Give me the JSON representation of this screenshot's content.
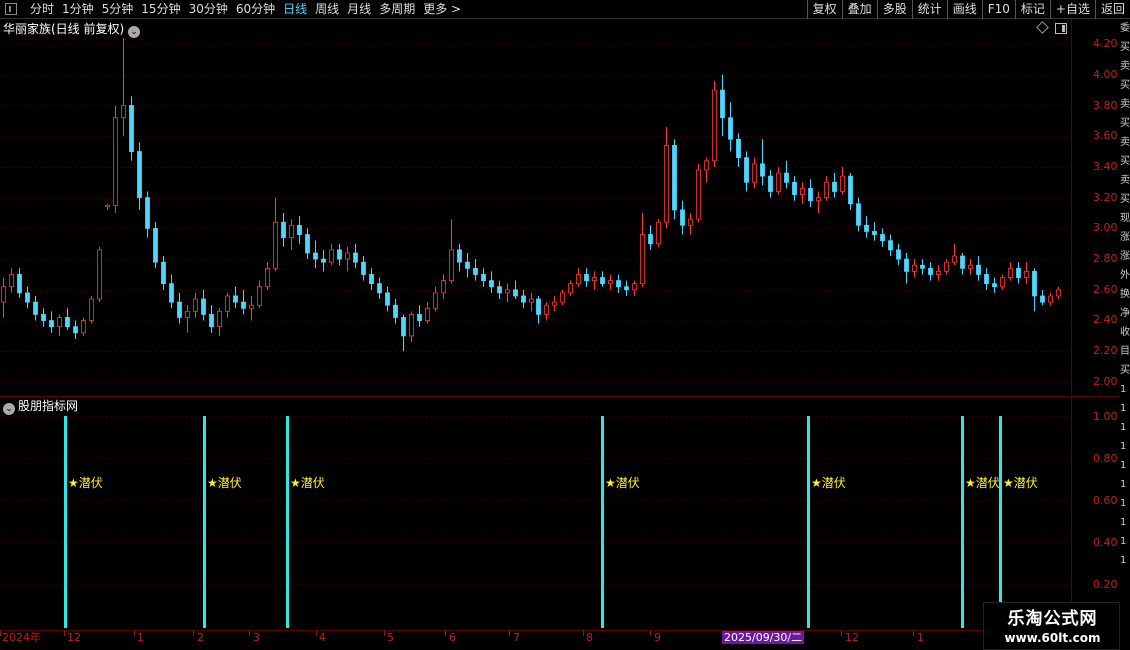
{
  "toolbar": {
    "period_tabs": [
      "分时",
      "1分钟",
      "5分钟",
      "15分钟",
      "30分钟",
      "60分钟",
      "日线",
      "周线",
      "月线",
      "多周期",
      "更多 >"
    ],
    "active_tab": "日线",
    "right_tools": [
      "复权",
      "叠加",
      "多股",
      "统计",
      "画线",
      "F10",
      "标记",
      "+自选",
      "返回"
    ]
  },
  "main_panel": {
    "title": "华丽家族(日线 前复权)",
    "price_axis": [
      "4.20",
      "4.00",
      "3.80",
      "3.60",
      "3.40",
      "3.20",
      "3.00",
      "2.80",
      "2.60",
      "2.40",
      "2.20",
      "2.00"
    ]
  },
  "indicator_panel": {
    "title": "股朋指标网",
    "axis": [
      "1.00",
      "0.80",
      "0.60",
      "0.40",
      "0.20"
    ],
    "signal_label": "★潜伏",
    "signals": [
      {
        "label": "★潜伏"
      },
      {
        "label": "★潜伏"
      },
      {
        "label": "★潜伏"
      },
      {
        "label": "★潜伏"
      },
      {
        "label": "★潜伏"
      },
      {
        "label": "★潜伏"
      },
      {
        "label": "★潜伏"
      }
    ]
  },
  "date_axis": {
    "labels": [
      "2024年",
      "12",
      "1",
      "2",
      "3",
      "4",
      "5",
      "6",
      "7",
      "8",
      "9",
      "12",
      "1"
    ],
    "cursor_date": "2025/09/30/二"
  },
  "right_strip": [
    "委",
    "买",
    "卖",
    "买",
    "卖",
    "买",
    "卖",
    "买",
    "卖",
    "买",
    "现",
    "涨",
    "涨",
    "外",
    "换",
    "净",
    "收",
    "目",
    "买",
    "1",
    "1",
    "1",
    "1",
    "1",
    "1",
    "1",
    "1",
    "1",
    "1"
  ],
  "watermark": {
    "title": "乐淘公式网",
    "url": "www.60lt.com"
  },
  "chart_data": {
    "type": "candlestick",
    "title": "华丽家族(日线 前复权)",
    "ylim": [
      2.0,
      4.2
    ],
    "up_color": "#ff3a3a",
    "down_color": "#4fd6ff",
    "indicator_color": "#2ee6e6",
    "ohlc": [
      [
        2.52,
        2.68,
        2.42,
        2.62
      ],
      [
        2.62,
        2.74,
        2.58,
        2.7
      ],
      [
        2.7,
        2.74,
        2.55,
        2.58
      ],
      [
        2.58,
        2.62,
        2.48,
        2.52
      ],
      [
        2.52,
        2.56,
        2.4,
        2.44
      ],
      [
        2.44,
        2.48,
        2.36,
        2.4
      ],
      [
        2.4,
        2.46,
        2.32,
        2.36
      ],
      [
        2.36,
        2.44,
        2.3,
        2.42
      ],
      [
        2.42,
        2.48,
        2.34,
        2.36
      ],
      [
        2.36,
        2.4,
        2.28,
        2.32
      ],
      [
        2.32,
        2.42,
        2.3,
        2.4
      ],
      [
        2.4,
        2.56,
        2.38,
        2.54
      ],
      [
        2.54,
        2.88,
        2.52,
        2.86
      ],
      [
        3.14,
        3.16,
        3.12,
        3.15
      ],
      [
        3.15,
        3.8,
        3.1,
        3.72
      ],
      [
        3.72,
        4.24,
        3.6,
        3.8
      ],
      [
        3.8,
        3.86,
        3.44,
        3.5
      ],
      [
        3.5,
        3.56,
        3.12,
        3.2
      ],
      [
        3.2,
        3.24,
        2.94,
        3.0
      ],
      [
        3.0,
        3.04,
        2.74,
        2.78
      ],
      [
        2.78,
        2.82,
        2.6,
        2.64
      ],
      [
        2.64,
        2.7,
        2.48,
        2.52
      ],
      [
        2.52,
        2.58,
        2.38,
        2.42
      ],
      [
        2.42,
        2.5,
        2.32,
        2.46
      ],
      [
        2.46,
        2.58,
        2.42,
        2.54
      ],
      [
        2.54,
        2.6,
        2.4,
        2.44
      ],
      [
        2.44,
        2.5,
        2.32,
        2.36
      ],
      [
        2.36,
        2.48,
        2.3,
        2.46
      ],
      [
        2.46,
        2.58,
        2.42,
        2.56
      ],
      [
        2.56,
        2.62,
        2.48,
        2.52
      ],
      [
        2.52,
        2.6,
        2.44,
        2.48
      ],
      [
        2.48,
        2.56,
        2.4,
        2.5
      ],
      [
        2.5,
        2.66,
        2.48,
        2.62
      ],
      [
        2.62,
        2.78,
        2.6,
        2.74
      ],
      [
        2.74,
        3.2,
        2.72,
        3.04
      ],
      [
        3.04,
        3.1,
        2.88,
        2.94
      ],
      [
        2.94,
        3.06,
        2.86,
        3.02
      ],
      [
        3.02,
        3.08,
        2.9,
        2.96
      ],
      [
        2.96,
        3.0,
        2.8,
        2.84
      ],
      [
        2.84,
        2.92,
        2.74,
        2.8
      ],
      [
        2.8,
        2.86,
        2.72,
        2.78
      ],
      [
        2.78,
        2.9,
        2.76,
        2.86
      ],
      [
        2.86,
        2.9,
        2.76,
        2.8
      ],
      [
        2.8,
        2.88,
        2.72,
        2.84
      ],
      [
        2.84,
        2.9,
        2.74,
        2.78
      ],
      [
        2.78,
        2.82,
        2.66,
        2.7
      ],
      [
        2.7,
        2.74,
        2.6,
        2.64
      ],
      [
        2.64,
        2.68,
        2.54,
        2.58
      ],
      [
        2.58,
        2.62,
        2.46,
        2.5
      ],
      [
        2.5,
        2.54,
        2.38,
        2.42
      ],
      [
        2.42,
        2.44,
        2.2,
        2.3
      ],
      [
        2.3,
        2.46,
        2.26,
        2.44
      ],
      [
        2.44,
        2.5,
        2.36,
        2.4
      ],
      [
        2.4,
        2.52,
        2.38,
        2.48
      ],
      [
        2.48,
        2.62,
        2.46,
        2.58
      ],
      [
        2.58,
        2.7,
        2.54,
        2.66
      ],
      [
        2.66,
        3.06,
        2.64,
        2.86
      ],
      [
        2.86,
        2.9,
        2.72,
        2.78
      ],
      [
        2.78,
        2.84,
        2.68,
        2.74
      ],
      [
        2.74,
        2.8,
        2.66,
        2.7
      ],
      [
        2.7,
        2.74,
        2.62,
        2.66
      ],
      [
        2.66,
        2.72,
        2.58,
        2.62
      ],
      [
        2.62,
        2.66,
        2.54,
        2.58
      ],
      [
        2.58,
        2.64,
        2.52,
        2.6
      ],
      [
        2.6,
        2.66,
        2.54,
        2.56
      ],
      [
        2.56,
        2.6,
        2.48,
        2.52
      ],
      [
        2.52,
        2.58,
        2.46,
        2.54
      ],
      [
        2.54,
        2.56,
        2.38,
        2.44
      ],
      [
        2.44,
        2.52,
        2.4,
        2.5
      ],
      [
        2.5,
        2.56,
        2.46,
        2.52
      ],
      [
        2.52,
        2.6,
        2.5,
        2.58
      ],
      [
        2.58,
        2.66,
        2.56,
        2.64
      ],
      [
        2.64,
        2.74,
        2.62,
        2.7
      ],
      [
        2.7,
        2.74,
        2.62,
        2.66
      ],
      [
        2.66,
        2.72,
        2.6,
        2.68
      ],
      [
        2.68,
        2.72,
        2.62,
        2.64
      ],
      [
        2.64,
        2.7,
        2.6,
        2.66
      ],
      [
        2.66,
        2.7,
        2.58,
        2.62
      ],
      [
        2.62,
        2.66,
        2.56,
        2.6
      ],
      [
        2.6,
        2.66,
        2.56,
        2.64
      ],
      [
        2.64,
        3.1,
        2.62,
        2.96
      ],
      [
        2.96,
        3.02,
        2.86,
        2.9
      ],
      [
        2.9,
        3.06,
        2.88,
        3.04
      ],
      [
        3.04,
        3.66,
        3.0,
        3.54
      ],
      [
        3.54,
        3.58,
        3.06,
        3.12
      ],
      [
        3.12,
        3.18,
        2.96,
        3.02
      ],
      [
        3.02,
        3.1,
        2.96,
        3.06
      ],
      [
        3.06,
        3.42,
        3.04,
        3.38
      ],
      [
        3.38,
        3.46,
        3.3,
        3.44
      ],
      [
        3.44,
        3.96,
        3.4,
        3.9
      ],
      [
        3.9,
        4.0,
        3.6,
        3.72
      ],
      [
        3.72,
        3.82,
        3.5,
        3.58
      ],
      [
        3.58,
        3.62,
        3.4,
        3.46
      ],
      [
        3.46,
        3.5,
        3.24,
        3.3
      ],
      [
        3.3,
        3.46,
        3.26,
        3.42
      ],
      [
        3.42,
        3.58,
        3.28,
        3.34
      ],
      [
        3.34,
        3.38,
        3.2,
        3.24
      ],
      [
        3.24,
        3.4,
        3.22,
        3.36
      ],
      [
        3.36,
        3.44,
        3.26,
        3.3
      ],
      [
        3.3,
        3.34,
        3.18,
        3.22
      ],
      [
        3.22,
        3.3,
        3.16,
        3.26
      ],
      [
        3.26,
        3.32,
        3.14,
        3.18
      ],
      [
        3.18,
        3.24,
        3.1,
        3.2
      ],
      [
        3.2,
        3.34,
        3.18,
        3.3
      ],
      [
        3.3,
        3.36,
        3.2,
        3.24
      ],
      [
        3.24,
        3.4,
        3.22,
        3.34
      ],
      [
        3.34,
        3.36,
        3.12,
        3.16
      ],
      [
        3.16,
        3.2,
        2.98,
        3.02
      ],
      [
        3.02,
        3.08,
        2.94,
        2.98
      ],
      [
        2.98,
        3.04,
        2.92,
        2.96
      ],
      [
        2.96,
        3.0,
        2.88,
        2.92
      ],
      [
        2.92,
        2.96,
        2.82,
        2.86
      ],
      [
        2.86,
        2.9,
        2.76,
        2.8
      ],
      [
        2.8,
        2.84,
        2.64,
        2.72
      ],
      [
        2.72,
        2.8,
        2.68,
        2.76
      ],
      [
        2.76,
        2.8,
        2.7,
        2.74
      ],
      [
        2.74,
        2.78,
        2.66,
        2.7
      ],
      [
        2.7,
        2.76,
        2.66,
        2.72
      ],
      [
        2.72,
        2.8,
        2.7,
        2.78
      ],
      [
        2.78,
        2.9,
        2.76,
        2.82
      ],
      [
        2.82,
        2.84,
        2.7,
        2.74
      ],
      [
        2.74,
        2.8,
        2.7,
        2.76
      ],
      [
        2.76,
        2.82,
        2.66,
        2.7
      ],
      [
        2.7,
        2.74,
        2.6,
        2.64
      ],
      [
        2.64,
        2.68,
        2.58,
        2.62
      ],
      [
        2.62,
        2.7,
        2.6,
        2.68
      ],
      [
        2.68,
        2.78,
        2.66,
        2.74
      ],
      [
        2.74,
        2.78,
        2.64,
        2.68
      ],
      [
        2.68,
        2.78,
        2.64,
        2.72
      ],
      [
        2.72,
        2.74,
        2.46,
        2.56
      ],
      [
        2.56,
        2.6,
        2.5,
        2.52
      ],
      [
        2.52,
        2.58,
        2.5,
        2.56
      ],
      [
        2.56,
        2.62,
        2.54,
        2.6
      ]
    ],
    "indicator_max": 1.0,
    "indicator_values": "1.00 at each signal bar"
  }
}
